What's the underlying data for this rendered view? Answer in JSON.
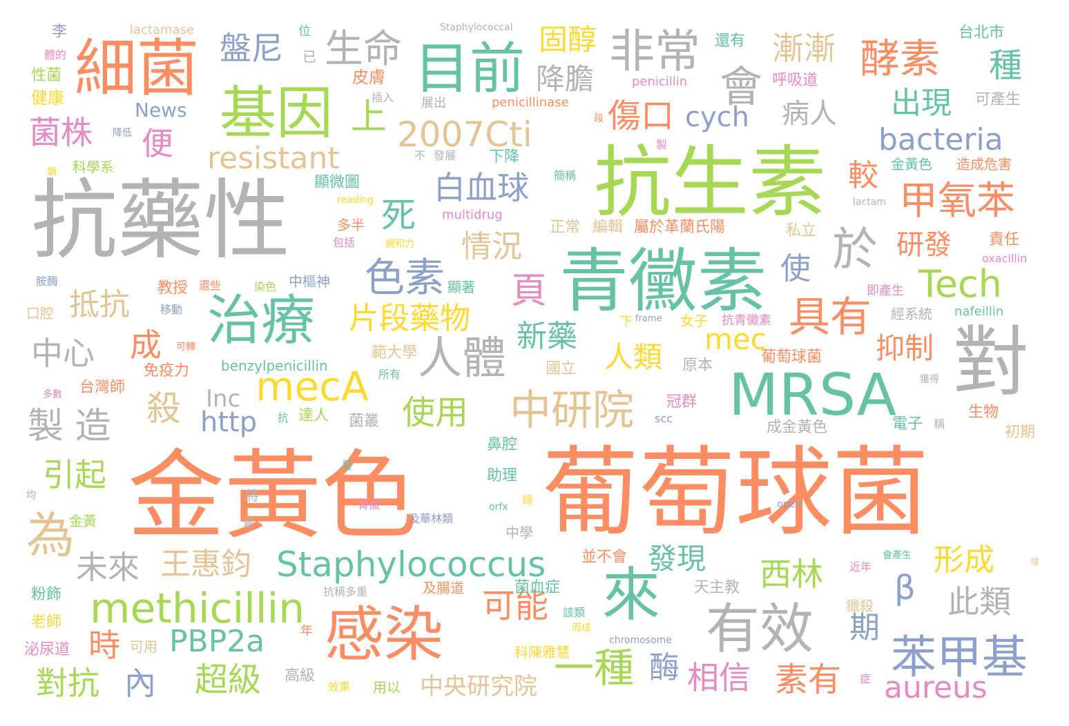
{
  "colors": {
    "orange": "#fc8d62",
    "green": "#66c2a5",
    "blue": "#8da0cb",
    "pink": "#e78ac3",
    "lime": "#a6d854",
    "yellow": "#ffd92f",
    "tan": "#e5c494",
    "gray": "#b3b3b3"
  },
  "words": [
    {
      "text": "金黃色",
      "color": "orange"
    },
    {
      "text": "葡萄球菌",
      "color": "orange"
    },
    {
      "text": "抗藥性",
      "color": "gray"
    },
    {
      "text": "抗生素",
      "color": "lime"
    },
    {
      "text": "青黴素",
      "color": "green"
    },
    {
      "text": "基因",
      "color": "lime"
    },
    {
      "text": "細菌",
      "color": "orange"
    },
    {
      "text": "目前",
      "color": "green"
    },
    {
      "text": "MRSA",
      "color": "green"
    },
    {
      "text": "感染",
      "color": "orange"
    },
    {
      "text": "對",
      "color": "gray"
    },
    {
      "text": "治療",
      "color": "green"
    },
    {
      "text": "來",
      "color": "green"
    },
    {
      "text": "有效",
      "color": "gray"
    },
    {
      "text": "非常",
      "color": "gray"
    },
    {
      "text": "於",
      "color": "gray"
    },
    {
      "text": "人體",
      "color": "gray"
    },
    {
      "text": "中研院",
      "color": "tan"
    },
    {
      "text": "methicillin",
      "color": "lime"
    },
    {
      "text": "Staphylococcus",
      "color": "green"
    },
    {
      "text": "2007Cti",
      "color": "tan"
    },
    {
      "text": "色素",
      "color": "blue"
    },
    {
      "text": "生命",
      "color": "gray"
    },
    {
      "text": "酵素",
      "color": "orange"
    },
    {
      "text": "甲氧苯",
      "color": "orange"
    },
    {
      "text": "具有",
      "color": "orange"
    },
    {
      "text": "苯甲基",
      "color": "blue"
    },
    {
      "text": "會",
      "color": "gray"
    },
    {
      "text": "為",
      "color": "tan"
    },
    {
      "text": "mecA",
      "color": "yellow"
    },
    {
      "text": "傷口",
      "color": "orange"
    },
    {
      "text": "cych",
      "color": "blue"
    },
    {
      "text": "Tech",
      "color": "lime"
    },
    {
      "text": "bacteria",
      "color": "blue"
    },
    {
      "text": "resistant",
      "color": "tan"
    },
    {
      "text": "白血球",
      "color": "blue"
    },
    {
      "text": "上",
      "color": "lime"
    },
    {
      "text": "片段藥物",
      "color": "yellow"
    },
    {
      "text": "頁",
      "color": "pink"
    },
    {
      "text": "固醇",
      "color": "yellow"
    },
    {
      "text": "降膽",
      "color": "gray"
    },
    {
      "text": "盤尼",
      "color": "blue"
    },
    {
      "text": "漸漸",
      "color": "tan"
    },
    {
      "text": "種",
      "color": "green"
    },
    {
      "text": "出現",
      "color": "green"
    },
    {
      "text": "病人",
      "color": "gray"
    },
    {
      "text": "菌株",
      "color": "pink"
    },
    {
      "text": "便",
      "color": "pink"
    },
    {
      "text": "死",
      "color": "green"
    },
    {
      "text": "情況",
      "color": "tan"
    },
    {
      "text": "較",
      "color": "orange"
    },
    {
      "text": "研發",
      "color": "orange"
    },
    {
      "text": "使",
      "color": "blue"
    },
    {
      "text": "新藥",
      "color": "green"
    },
    {
      "text": "人類",
      "color": "yellow"
    },
    {
      "text": "mec",
      "color": "yellow"
    },
    {
      "text": "抑制",
      "color": "orange"
    },
    {
      "text": "抵抗",
      "color": "tan"
    },
    {
      "text": "中心",
      "color": "gray"
    },
    {
      "text": "成",
      "color": "orange"
    },
    {
      "text": "殺",
      "color": "tan"
    },
    {
      "text": "製 造",
      "color": "gray"
    },
    {
      "text": "http",
      "color": "blue"
    },
    {
      "text": "Inc",
      "color": "gray"
    },
    {
      "text": "使用",
      "color": "lime"
    },
    {
      "text": "引起",
      "color": "lime"
    },
    {
      "text": "未來",
      "color": "gray"
    },
    {
      "text": "王惠鈞",
      "color": "tan"
    },
    {
      "text": "發現",
      "color": "green"
    },
    {
      "text": "西林",
      "color": "lime"
    },
    {
      "text": "β",
      "color": "blue"
    },
    {
      "text": "形成",
      "color": "yellow"
    },
    {
      "text": "此類",
      "color": "gray"
    },
    {
      "text": "期",
      "color": "blue"
    },
    {
      "text": "可能",
      "color": "orange"
    },
    {
      "text": "PBP2a",
      "color": "green"
    },
    {
      "text": "時",
      "color": "orange"
    },
    {
      "text": "對抗",
      "color": "lime"
    },
    {
      "text": "內",
      "color": "blue"
    },
    {
      "text": "超級",
      "color": "lime"
    },
    {
      "text": "一種",
      "color": "lime"
    },
    {
      "text": "酶",
      "color": "blue"
    },
    {
      "text": "相信",
      "color": "pink"
    },
    {
      "text": "素有",
      "color": "orange"
    },
    {
      "text": "aureus",
      "color": "pink"
    },
    {
      "text": "中央研究院",
      "color": "tan"
    },
    {
      "text": "News",
      "color": "blue"
    },
    {
      "text": "李",
      "color": "blue"
    },
    {
      "text": "體的",
      "color": "pink"
    },
    {
      "text": "性菌",
      "color": "lime"
    },
    {
      "text": "健康",
      "color": "yellow"
    },
    {
      "text": "lactamase",
      "color": "tan"
    },
    {
      "text": "位",
      "color": "green"
    },
    {
      "text": "已",
      "color": "gray"
    },
    {
      "text": "Staphylococcal",
      "color": "gray"
    },
    {
      "text": "還有",
      "color": "green"
    },
    {
      "text": "台北市",
      "color": "green"
    },
    {
      "text": "皮膚",
      "color": "orange"
    },
    {
      "text": "呼吸道",
      "color": "pink"
    },
    {
      "text": "penicillin",
      "color": "pink"
    },
    {
      "text": "插入",
      "color": "gray"
    },
    {
      "text": "展出",
      "color": "gray"
    },
    {
      "text": "penicillinase",
      "color": "orange"
    },
    {
      "text": "可產生",
      "color": "gray"
    },
    {
      "text": "段",
      "color": "orange"
    },
    {
      "text": "降低",
      "color": "blue"
    },
    {
      "text": "不",
      "color": "gray"
    },
    {
      "text": "發展",
      "color": "gray"
    },
    {
      "text": "下降",
      "color": "green"
    },
    {
      "text": "製",
      "color": "pink"
    },
    {
      "text": "金黃色",
      "color": "green"
    },
    {
      "text": "造成危害",
      "color": "orange"
    },
    {
      "text": "科學系",
      "color": "lime"
    },
    {
      "text": "類",
      "color": "yellow"
    },
    {
      "text": "簡稱",
      "color": "green"
    },
    {
      "text": "顯微圖",
      "color": "green"
    },
    {
      "text": "reading",
      "color": "yellow"
    },
    {
      "text": "lactam",
      "color": "gray"
    },
    {
      "text": "multidrug",
      "color": "pink"
    },
    {
      "text": "多半",
      "color": "orange"
    },
    {
      "text": "包括",
      "color": "pink"
    },
    {
      "text": "親和力",
      "color": "yellow"
    },
    {
      "text": "正常",
      "color": "tan"
    },
    {
      "text": "編輯",
      "color": "tan"
    },
    {
      "text": "屬於革蘭氏陽",
      "color": "orange"
    },
    {
      "text": "私立",
      "color": "tan"
    },
    {
      "text": "責任",
      "color": "orange"
    },
    {
      "text": "oxacillin",
      "color": "pink"
    },
    {
      "text": "胺酶",
      "color": "blue"
    },
    {
      "text": "教授",
      "color": "orange"
    },
    {
      "text": "還些",
      "color": "orange"
    },
    {
      "text": "染色",
      "color": "lime"
    },
    {
      "text": "中樞神",
      "color": "blue"
    },
    {
      "text": "顯著",
      "color": "green"
    },
    {
      "text": "即產生",
      "color": "pink"
    },
    {
      "text": "口腔",
      "color": "tan"
    },
    {
      "text": "移動",
      "color": "blue"
    },
    {
      "text": "經系統",
      "color": "gray"
    },
    {
      "text": "nafeillin",
      "color": "green"
    },
    {
      "text": "下",
      "color": "yellow"
    },
    {
      "text": "frame",
      "color": "blue"
    },
    {
      "text": "女子",
      "color": "yellow"
    },
    {
      "text": "抗青黴素",
      "color": "pink"
    },
    {
      "text": "可轉",
      "color": "orange"
    },
    {
      "text": "範大學",
      "color": "tan"
    },
    {
      "text": "免疫力",
      "color": "orange"
    },
    {
      "text": "benzylpenicillin",
      "color": "green"
    },
    {
      "text": "所有",
      "color": "green"
    },
    {
      "text": "國立",
      "color": "tan"
    },
    {
      "text": "原本",
      "color": "gray"
    },
    {
      "text": "葡萄球菌",
      "color": "orange"
    },
    {
      "text": "台灣師",
      "color": "orange"
    },
    {
      "text": "多數",
      "color": "pink"
    },
    {
      "text": "冠群",
      "color": "pink"
    },
    {
      "text": "獲得",
      "color": "gray"
    },
    {
      "text": "抗",
      "color": "green"
    },
    {
      "text": "達人",
      "color": "lime"
    },
    {
      "text": "菌叢",
      "color": "gray"
    },
    {
      "text": "scc",
      "color": "blue"
    },
    {
      "text": "成金黃色",
      "color": "gray"
    },
    {
      "text": "電子",
      "color": "green"
    },
    {
      "text": "稱",
      "color": "gray"
    },
    {
      "text": "生物",
      "color": "orange"
    },
    {
      "text": "初期",
      "color": "tan"
    },
    {
      "text": "鼻腔",
      "color": "green"
    },
    {
      "text": "發",
      "color": "green"
    },
    {
      "text": "助理",
      "color": "green"
    },
    {
      "text": "均",
      "color": "pink"
    },
    {
      "text": "將",
      "color": "gray"
    },
    {
      "text": "青黴",
      "color": "pink"
    },
    {
      "text": "orfx",
      "color": "green"
    },
    {
      "text": "錄",
      "color": "yellow"
    },
    {
      "text": "open",
      "color": "blue"
    },
    {
      "text": "金黃",
      "color": "lime"
    },
    {
      "text": "醫",
      "color": "gray"
    },
    {
      "text": "及華林類",
      "color": "blue"
    },
    {
      "text": "中學",
      "color": "gray"
    },
    {
      "text": "並不會",
      "color": "orange"
    },
    {
      "text": "增",
      "color": "tan"
    },
    {
      "text": "粉飾",
      "color": "green"
    },
    {
      "text": "抗稱多重",
      "color": "gray"
    },
    {
      "text": "及腸道",
      "color": "orange"
    },
    {
      "text": "菌血症",
      "color": "green"
    },
    {
      "text": "天主教",
      "color": "gray"
    },
    {
      "text": "近年",
      "color": "pink"
    },
    {
      "text": "會產生",
      "color": "green"
    },
    {
      "text": "獵殺",
      "color": "tan"
    },
    {
      "text": "老師",
      "color": "yellow"
    },
    {
      "text": "年",
      "color": "orange"
    },
    {
      "text": "該類",
      "color": "green"
    },
    {
      "text": "而成",
      "color": "yellow"
    },
    {
      "text": "chromosome",
      "color": "blue"
    },
    {
      "text": "泌尿道",
      "color": "pink"
    },
    {
      "text": "可用",
      "color": "tan"
    },
    {
      "text": "科陳雅慧",
      "color": "yellow"
    },
    {
      "text": "高級",
      "color": "gray"
    },
    {
      "text": "效果",
      "color": "yellow"
    },
    {
      "text": "用以",
      "color": "lime"
    },
    {
      "text": "症",
      "color": "pink"
    }
  ]
}
